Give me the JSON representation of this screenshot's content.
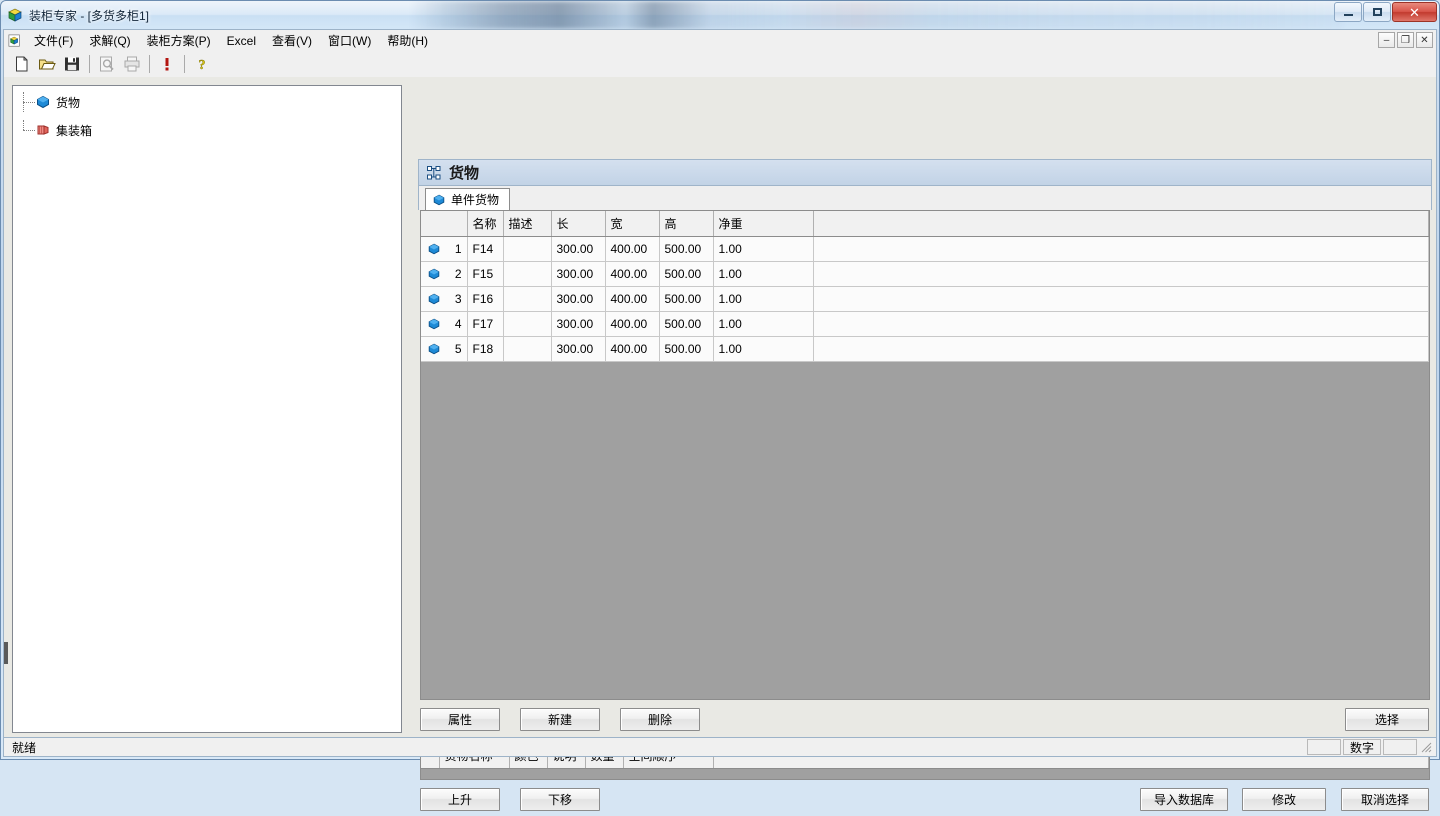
{
  "window": {
    "title": "装柜专家 - [多货多柜1]",
    "app_icon": "cube-icon",
    "controls": {
      "minimize": "minimize-icon",
      "maximize": "maximize-icon",
      "close": "✕"
    },
    "mdi_controls": {
      "minimize": "–",
      "restore": "❐",
      "close": "✕"
    }
  },
  "menubar": {
    "doc_icon": "document-cube-icon",
    "items": [
      {
        "label": "文件(F)"
      },
      {
        "label": "求解(Q)"
      },
      {
        "label": "装柜方案(P)"
      },
      {
        "label": "Excel"
      },
      {
        "label": "查看(V)"
      },
      {
        "label": "窗口(W)"
      },
      {
        "label": "帮助(H)"
      }
    ]
  },
  "toolbar": {
    "buttons": [
      {
        "name": "new-file-icon",
        "enabled": true
      },
      {
        "name": "open-folder-icon",
        "enabled": true
      },
      {
        "name": "save-disk-icon",
        "enabled": true
      },
      {
        "name": "print-preview-icon",
        "enabled": false
      },
      {
        "name": "print-icon",
        "enabled": false
      },
      {
        "name": "run-exclamation-icon",
        "enabled": true
      },
      {
        "name": "help-question-icon",
        "enabled": true
      }
    ]
  },
  "tree": {
    "items": [
      {
        "label": "货物",
        "icon": "blue-hexagon-icon"
      },
      {
        "label": "集装箱",
        "icon": "red-container-icon"
      }
    ]
  },
  "form": {
    "header_icon": "nodes-icon",
    "title": "货物",
    "tabs": [
      {
        "label": "单件货物",
        "icon": "blue-hexagon-icon",
        "active": true
      }
    ]
  },
  "grid": {
    "columns": [
      "",
      "名称",
      "描述",
      "长",
      "宽",
      "高",
      "净重",
      ""
    ],
    "rows": [
      {
        "num": "1",
        "icon": "blue-hexagon-icon",
        "name": "F14",
        "desc": "",
        "length": "300.00",
        "width": "400.00",
        "height": "500.00",
        "weight": "1.00"
      },
      {
        "num": "2",
        "icon": "blue-hexagon-icon",
        "name": "F15",
        "desc": "",
        "length": "300.00",
        "width": "400.00",
        "height": "500.00",
        "weight": "1.00"
      },
      {
        "num": "3",
        "icon": "blue-hexagon-icon",
        "name": "F16",
        "desc": "",
        "length": "300.00",
        "width": "400.00",
        "height": "500.00",
        "weight": "1.00"
      },
      {
        "num": "4",
        "icon": "blue-hexagon-icon",
        "name": "F17",
        "desc": "",
        "length": "300.00",
        "width": "400.00",
        "height": "500.00",
        "weight": "1.00"
      },
      {
        "num": "5",
        "icon": "blue-hexagon-icon",
        "name": "F18",
        "desc": "",
        "length": "300.00",
        "width": "400.00",
        "height": "500.00",
        "weight": "1.00"
      }
    ]
  },
  "buttons_primary": {
    "properties": "属性",
    "new": "新建",
    "delete": "删除",
    "select": "选择"
  },
  "lower_grid": {
    "columns": [
      "",
      "货物名称",
      "颜色",
      "说明",
      "数量",
      "空间顺序",
      ""
    ],
    "rows": []
  },
  "buttons_secondary": {
    "move_up": "上升",
    "move_down": "下移",
    "import_db": "导入数据库",
    "modify": "修改",
    "cancel_select": "取消选择"
  },
  "statusbar": {
    "text": "就绪",
    "panel_blank_1": "",
    "panel_num": "数字",
    "panel_blank_2": "",
    "grip": "resize-grip-icon"
  },
  "colors": {
    "aero_frame": "#bdd4ec",
    "form_header": "#c2d3e6",
    "grid_empty": "#a0a0a0",
    "hexagon_blue": "#1e8ad6",
    "container_red": "#e8716a",
    "close_red": "#c23a2e"
  }
}
